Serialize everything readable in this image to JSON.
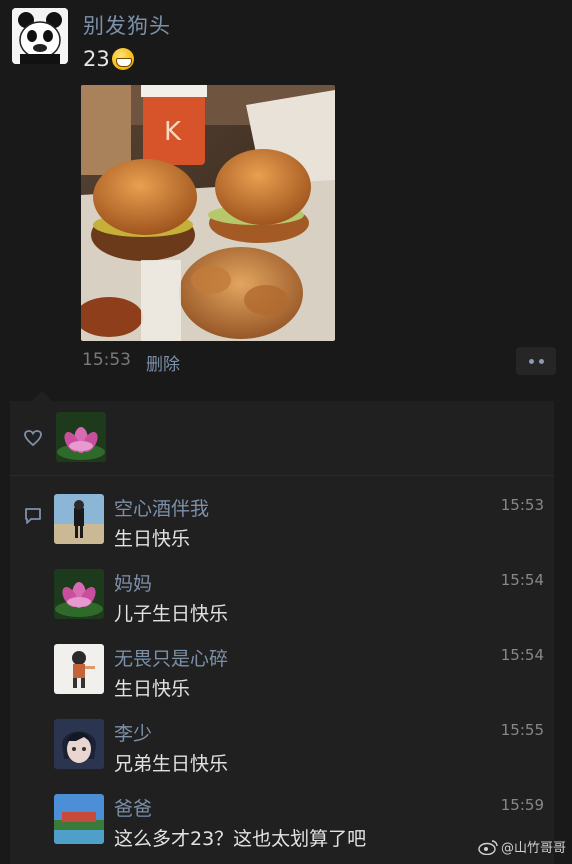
{
  "post": {
    "author": "别发狗头",
    "text": "23",
    "emoji_icon": "grinning-face-icon",
    "time": "15:53",
    "delete_label": "删除"
  },
  "likes": {
    "icon": "heart-icon"
  },
  "comments": [
    {
      "name": "空心酒伴我",
      "text": "生日快乐",
      "time": "15:53"
    },
    {
      "name": "妈妈",
      "text": "儿子生日快乐",
      "time": "15:54"
    },
    {
      "name": "无畏只是心碎",
      "text": "生日快乐",
      "time": "15:54"
    },
    {
      "name": "李少",
      "text": "兄弟生日快乐",
      "time": "15:55"
    },
    {
      "name": "爸爸",
      "text": "这么多才23？这也太划算了吧",
      "time": "15:59"
    }
  ],
  "watermark": "@山竹哥哥",
  "colors": {
    "background": "#191919",
    "panel": "#202020",
    "name_link": "#7d90a9"
  }
}
